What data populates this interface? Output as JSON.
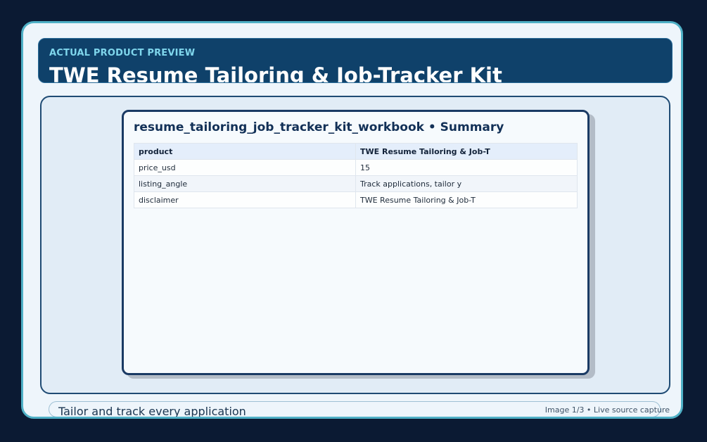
{
  "header": {
    "eyebrow": "ACTUAL PRODUCT PREVIEW",
    "title": "TWE Resume Tailoring & Job-Tracker Kit"
  },
  "preview": {
    "card_title": "resume_tailoring_job_tracker_kit_workbook • Summary",
    "table": {
      "header": [
        "product",
        "TWE Resume Tailoring & Job-T"
      ],
      "rows": [
        [
          "price_usd",
          "15"
        ],
        [
          "listing_angle",
          "Track applications, tailor y"
        ],
        [
          "disclaimer",
          "TWE Resume Tailoring & Job-T"
        ]
      ]
    }
  },
  "footer": {
    "caption": "Tailor and track every application",
    "image_status": "Image 1/3 • Live source capture"
  },
  "colors": {
    "page_background": "#0b1a33",
    "frame_border": "#4fb0c6",
    "header_background": "#0f416a",
    "eyebrow_text": "#7fd6ec"
  }
}
